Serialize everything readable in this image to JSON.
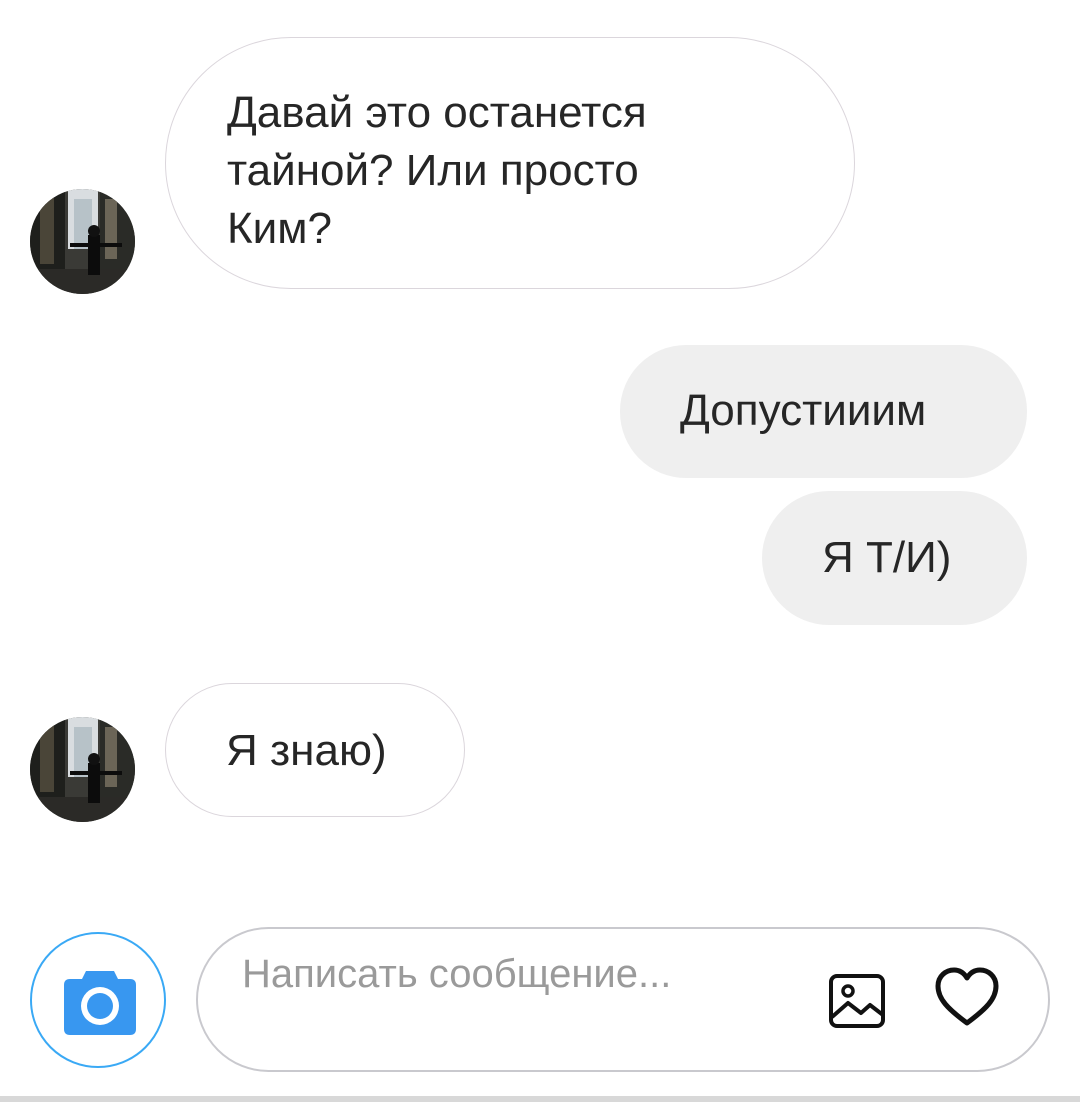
{
  "conversation": {
    "messages": [
      {
        "direction": "incoming",
        "lines": [
          "Давай это останется",
          "тайной? Или просто",
          "Ким?"
        ]
      },
      {
        "direction": "outgoing",
        "lines": [
          "Допустииим"
        ]
      },
      {
        "direction": "outgoing",
        "lines": [
          "Я Т/И)"
        ]
      },
      {
        "direction": "incoming",
        "lines": [
          "Я знаю)"
        ]
      }
    ]
  },
  "composer": {
    "placeholder": "Написать сообщение...",
    "value": "",
    "icons": {
      "camera": "camera-icon",
      "gallery": "image-icon",
      "like": "heart-icon"
    }
  },
  "colors": {
    "incoming_bubble_border": "#dbd6dc",
    "outgoing_bubble_bg": "#efefef",
    "camera_blue": "#3897f0",
    "camera_ring": "#3aa9f5",
    "text": "#262626",
    "placeholder": "#9a9a9a"
  }
}
